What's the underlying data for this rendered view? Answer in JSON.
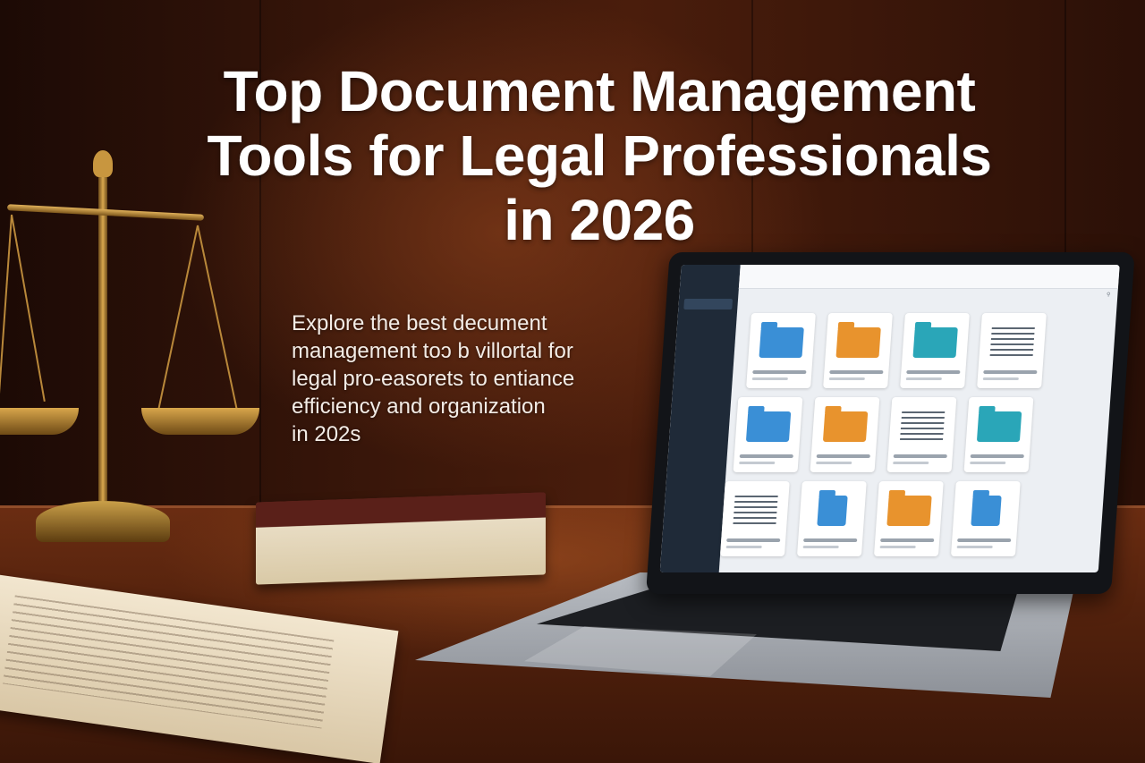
{
  "headline": {
    "line1": "Top Document Management",
    "line2": "Tools for Legal Professionals",
    "line3": "in 2026"
  },
  "subtext": {
    "line1": "Explore the best decument",
    "line2": "management toɔ b villortal for",
    "line3": "legal pro-easorets to entiance",
    "line4": "efficiency and organization",
    "line5": "in 202s"
  },
  "colors": {
    "text": "#ffffff",
    "wall": "#3b170a",
    "desk": "#6b2d12",
    "folder_blue": "#3a8fd6",
    "folder_orange": "#e8932d",
    "folder_teal": "#2aa6b8"
  },
  "laptop_screen": {
    "icons": [
      "folder-icon",
      "document-icon",
      "search-icon"
    ]
  }
}
